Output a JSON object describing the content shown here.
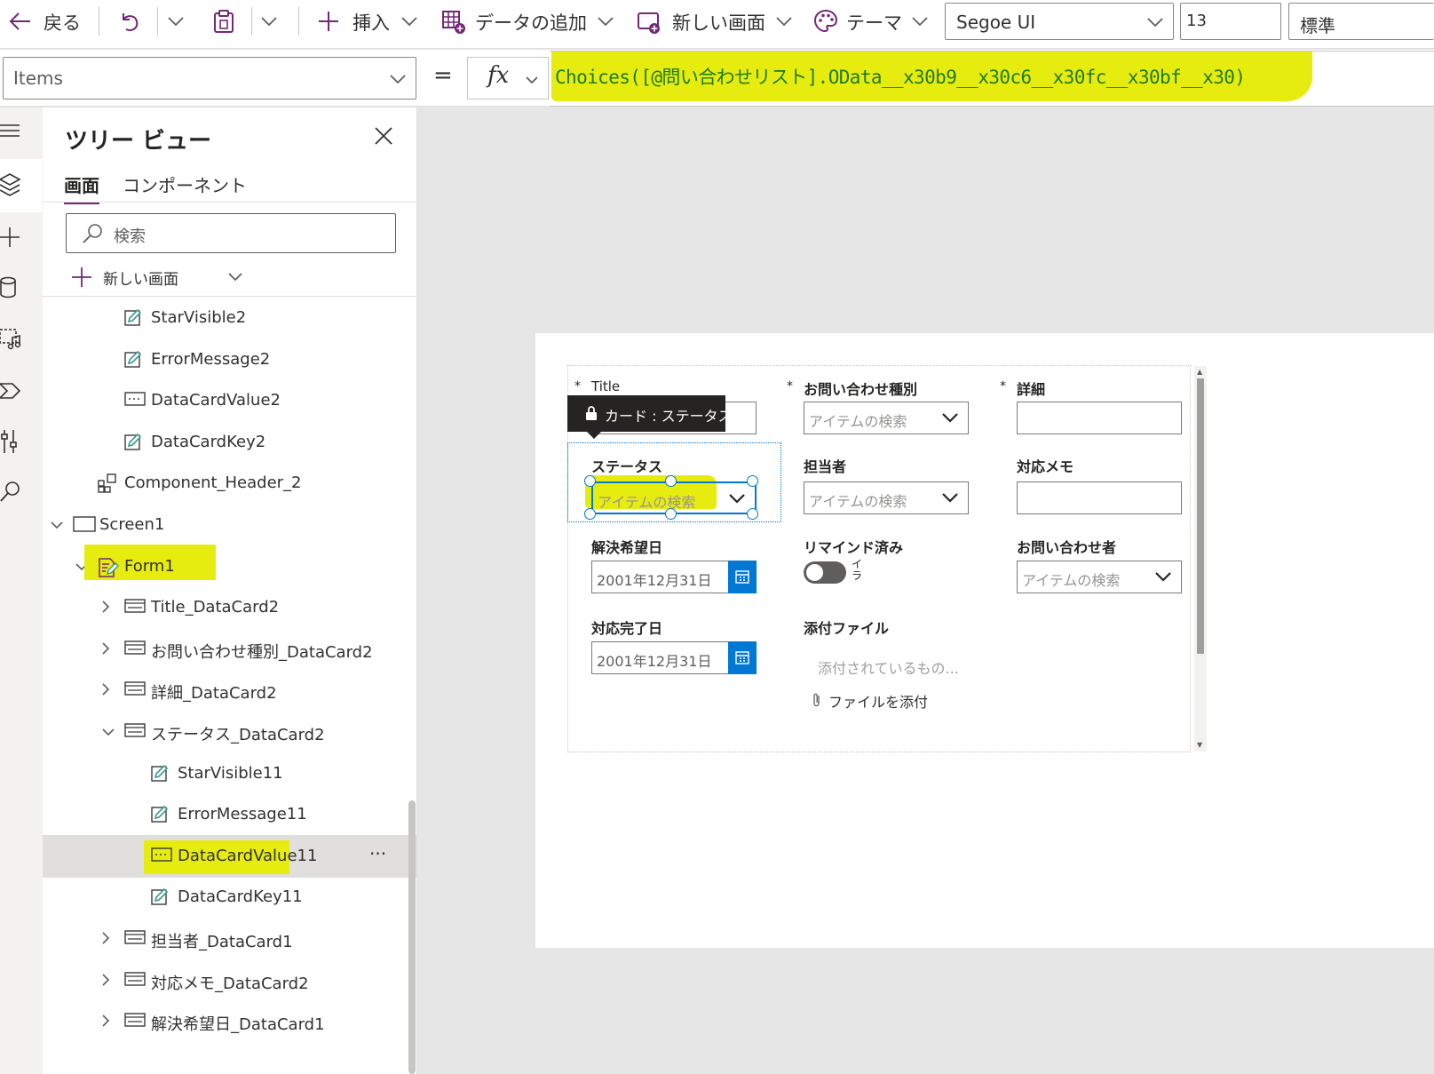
{
  "toolbar": {
    "back": "戻る",
    "insert": "挿入",
    "add_data": "データの追加",
    "new_screen": "新しい画面",
    "theme": "テーマ",
    "font": "Segoe UI",
    "font_size": "13",
    "weight": "標準"
  },
  "formula_bar": {
    "property": "Items",
    "equals": "=",
    "fx": "fx",
    "formula": "Choices([@問い合わせリスト].OData__x30b9__x30c6__x30fc__x30bf__x30)"
  },
  "tree_view": {
    "title": "ツリー ビュー",
    "tabs": [
      "画面",
      "コンポーネント"
    ],
    "search_placeholder": "検索",
    "new_screen": "新しい画面",
    "items": [
      {
        "label": "StarVisible2",
        "icon": "edit-icon",
        "level": 3
      },
      {
        "label": "ErrorMessage2",
        "icon": "edit-icon",
        "level": 3
      },
      {
        "label": "DataCardValue2",
        "icon": "textinput-icon",
        "level": 3
      },
      {
        "label": "DataCardKey2",
        "icon": "edit-icon",
        "level": 3
      },
      {
        "label": "Component_Header_2",
        "icon": "component-icon",
        "level": 2
      },
      {
        "label": "Screen1",
        "icon": "screen-icon",
        "level": 1,
        "expanded": true
      },
      {
        "label": "Form1",
        "icon": "form-icon",
        "level": 2,
        "expanded": true,
        "highlighted": true
      },
      {
        "label": "Title_DataCard2",
        "icon": "card-icon",
        "level": 3,
        "expanded": false
      },
      {
        "label": "お問い合わせ種別_DataCard2",
        "icon": "card-icon",
        "level": 3,
        "expanded": false
      },
      {
        "label": "詳細_DataCard2",
        "icon": "card-icon",
        "level": 3,
        "expanded": false
      },
      {
        "label": "ステータス_DataCard2",
        "icon": "card-icon",
        "level": 3,
        "expanded": true
      },
      {
        "label": "StarVisible11",
        "icon": "edit-icon",
        "level": 4
      },
      {
        "label": "ErrorMessage11",
        "icon": "edit-icon",
        "level": 4
      },
      {
        "label": "DataCardValue11",
        "icon": "textinput-icon",
        "level": 4,
        "selected": true,
        "highlighted": true
      },
      {
        "label": "DataCardKey11",
        "icon": "edit-icon",
        "level": 4
      },
      {
        "label": "担当者_DataCard1",
        "icon": "card-icon",
        "level": 3,
        "expanded": false
      },
      {
        "label": "対応メモ_DataCard2",
        "icon": "card-icon",
        "level": 3,
        "expanded": false
      },
      {
        "label": "解決希望日_DataCard1",
        "icon": "card-icon",
        "level": 3,
        "expanded": false
      }
    ],
    "more": "···"
  },
  "form": {
    "tooltip": "カード : ステータス",
    "fields": {
      "title": {
        "label": "Title",
        "required": "*"
      },
      "inquiry_type": {
        "label": "お問い合わせ種別",
        "required": "*",
        "placeholder": "アイテムの検索"
      },
      "detail": {
        "label": "詳細",
        "required": "*"
      },
      "status": {
        "label": "ステータス",
        "placeholder": "アイテムの検索"
      },
      "assignee": {
        "label": "担当者",
        "placeholder": "アイテムの検索"
      },
      "memo": {
        "label": "対応メモ"
      },
      "due_date": {
        "label": "解決希望日",
        "value": "2001年12月31日"
      },
      "reminded": {
        "label": "リマインド済み",
        "toggle_text": "イ\nラ",
        "toggle_on": false
      },
      "inquirer": {
        "label": "お問い合わせ者",
        "placeholder": "アイテムの検索"
      },
      "completed_date": {
        "label": "対応完了日",
        "value": "2001年12月31日"
      },
      "attachments": {
        "label": "添付ファイル",
        "empty_text": "添付されているもの...",
        "attach": "ファイルを添付"
      }
    }
  },
  "colors": {
    "accent": "#742774",
    "highlight": "#e7ec0f",
    "calendar": "#0078d4",
    "formula": "#1e7b1e"
  }
}
